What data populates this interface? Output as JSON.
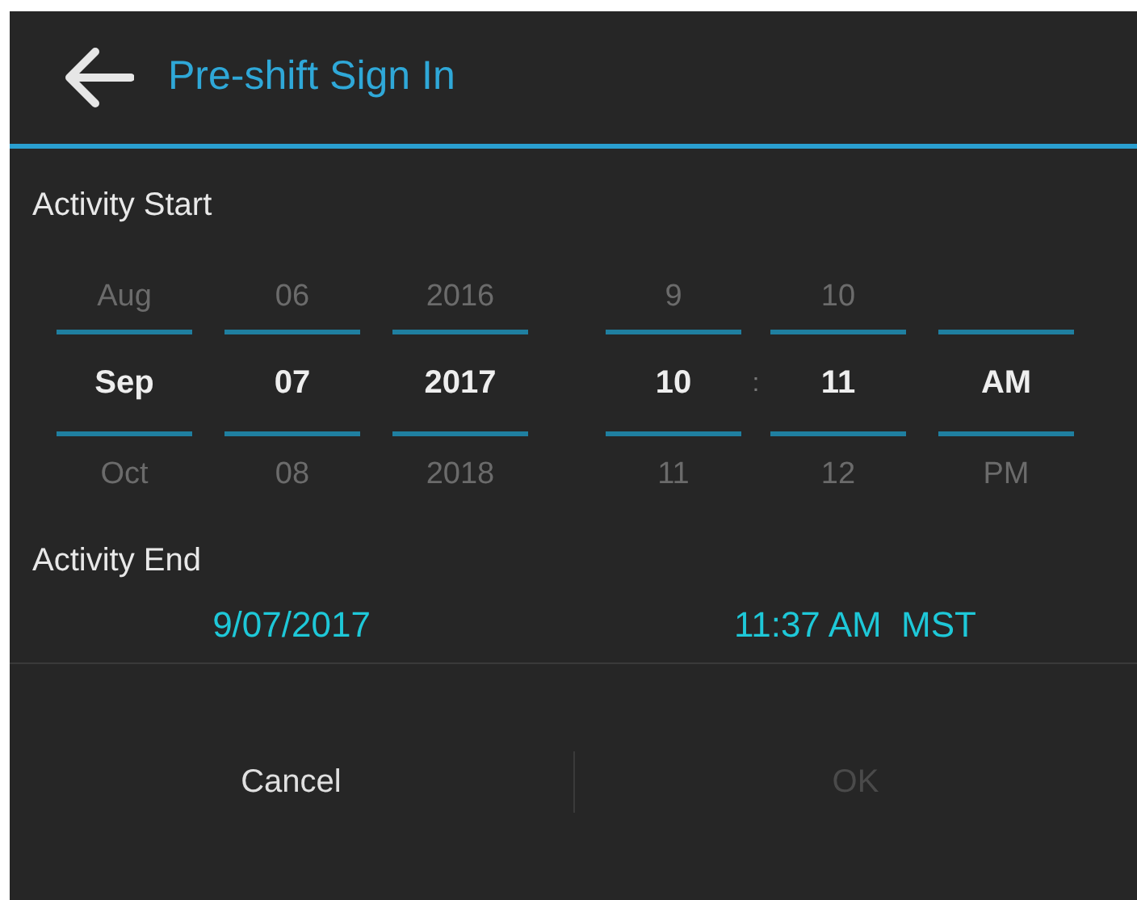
{
  "header": {
    "title": "Pre-shift Sign In"
  },
  "activity_start": {
    "label": "Activity Start",
    "date_columns": [
      {
        "prev": "Aug",
        "value": "Sep",
        "next": "Oct"
      },
      {
        "prev": "06",
        "value": "07",
        "next": "08"
      },
      {
        "prev": "2016",
        "value": "2017",
        "next": "2018"
      }
    ],
    "time_columns": [
      {
        "prev": "9",
        "value": "10",
        "next": "11"
      },
      {
        "prev": "10",
        "value": "11",
        "next": "12"
      },
      {
        "value": "AM",
        "next": "PM"
      }
    ],
    "time_separator": ":"
  },
  "activity_end": {
    "label": "Activity End",
    "date": "9/07/2017",
    "time": "11:37 AM  MST"
  },
  "buttons": [
    {
      "label": "Cancel",
      "disabled": false
    },
    {
      "label": "OK",
      "disabled": true
    }
  ]
}
